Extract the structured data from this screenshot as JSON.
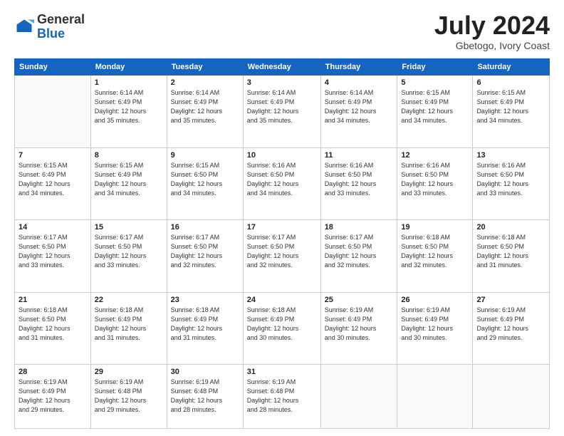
{
  "header": {
    "logo_general": "General",
    "logo_blue": "Blue",
    "title": "July 2024",
    "location": "Gbetogo, Ivory Coast"
  },
  "days_of_week": [
    "Sunday",
    "Monday",
    "Tuesday",
    "Wednesday",
    "Thursday",
    "Friday",
    "Saturday"
  ],
  "weeks": [
    [
      {
        "day": "",
        "info": ""
      },
      {
        "day": "1",
        "info": "Sunrise: 6:14 AM\nSunset: 6:49 PM\nDaylight: 12 hours\nand 35 minutes."
      },
      {
        "day": "2",
        "info": "Sunrise: 6:14 AM\nSunset: 6:49 PM\nDaylight: 12 hours\nand 35 minutes."
      },
      {
        "day": "3",
        "info": "Sunrise: 6:14 AM\nSunset: 6:49 PM\nDaylight: 12 hours\nand 35 minutes."
      },
      {
        "day": "4",
        "info": "Sunrise: 6:14 AM\nSunset: 6:49 PM\nDaylight: 12 hours\nand 34 minutes."
      },
      {
        "day": "5",
        "info": "Sunrise: 6:15 AM\nSunset: 6:49 PM\nDaylight: 12 hours\nand 34 minutes."
      },
      {
        "day": "6",
        "info": "Sunrise: 6:15 AM\nSunset: 6:49 PM\nDaylight: 12 hours\nand 34 minutes."
      }
    ],
    [
      {
        "day": "7",
        "info": "Sunrise: 6:15 AM\nSunset: 6:49 PM\nDaylight: 12 hours\nand 34 minutes."
      },
      {
        "day": "8",
        "info": "Sunrise: 6:15 AM\nSunset: 6:49 PM\nDaylight: 12 hours\nand 34 minutes."
      },
      {
        "day": "9",
        "info": "Sunrise: 6:15 AM\nSunset: 6:50 PM\nDaylight: 12 hours\nand 34 minutes."
      },
      {
        "day": "10",
        "info": "Sunrise: 6:16 AM\nSunset: 6:50 PM\nDaylight: 12 hours\nand 34 minutes."
      },
      {
        "day": "11",
        "info": "Sunrise: 6:16 AM\nSunset: 6:50 PM\nDaylight: 12 hours\nand 33 minutes."
      },
      {
        "day": "12",
        "info": "Sunrise: 6:16 AM\nSunset: 6:50 PM\nDaylight: 12 hours\nand 33 minutes."
      },
      {
        "day": "13",
        "info": "Sunrise: 6:16 AM\nSunset: 6:50 PM\nDaylight: 12 hours\nand 33 minutes."
      }
    ],
    [
      {
        "day": "14",
        "info": "Sunrise: 6:17 AM\nSunset: 6:50 PM\nDaylight: 12 hours\nand 33 minutes."
      },
      {
        "day": "15",
        "info": "Sunrise: 6:17 AM\nSunset: 6:50 PM\nDaylight: 12 hours\nand 33 minutes."
      },
      {
        "day": "16",
        "info": "Sunrise: 6:17 AM\nSunset: 6:50 PM\nDaylight: 12 hours\nand 32 minutes."
      },
      {
        "day": "17",
        "info": "Sunrise: 6:17 AM\nSunset: 6:50 PM\nDaylight: 12 hours\nand 32 minutes."
      },
      {
        "day": "18",
        "info": "Sunrise: 6:17 AM\nSunset: 6:50 PM\nDaylight: 12 hours\nand 32 minutes."
      },
      {
        "day": "19",
        "info": "Sunrise: 6:18 AM\nSunset: 6:50 PM\nDaylight: 12 hours\nand 32 minutes."
      },
      {
        "day": "20",
        "info": "Sunrise: 6:18 AM\nSunset: 6:50 PM\nDaylight: 12 hours\nand 31 minutes."
      }
    ],
    [
      {
        "day": "21",
        "info": "Sunrise: 6:18 AM\nSunset: 6:50 PM\nDaylight: 12 hours\nand 31 minutes."
      },
      {
        "day": "22",
        "info": "Sunrise: 6:18 AM\nSunset: 6:49 PM\nDaylight: 12 hours\nand 31 minutes."
      },
      {
        "day": "23",
        "info": "Sunrise: 6:18 AM\nSunset: 6:49 PM\nDaylight: 12 hours\nand 31 minutes."
      },
      {
        "day": "24",
        "info": "Sunrise: 6:18 AM\nSunset: 6:49 PM\nDaylight: 12 hours\nand 30 minutes."
      },
      {
        "day": "25",
        "info": "Sunrise: 6:19 AM\nSunset: 6:49 PM\nDaylight: 12 hours\nand 30 minutes."
      },
      {
        "day": "26",
        "info": "Sunrise: 6:19 AM\nSunset: 6:49 PM\nDaylight: 12 hours\nand 30 minutes."
      },
      {
        "day": "27",
        "info": "Sunrise: 6:19 AM\nSunset: 6:49 PM\nDaylight: 12 hours\nand 29 minutes."
      }
    ],
    [
      {
        "day": "28",
        "info": "Sunrise: 6:19 AM\nSunset: 6:49 PM\nDaylight: 12 hours\nand 29 minutes."
      },
      {
        "day": "29",
        "info": "Sunrise: 6:19 AM\nSunset: 6:48 PM\nDaylight: 12 hours\nand 29 minutes."
      },
      {
        "day": "30",
        "info": "Sunrise: 6:19 AM\nSunset: 6:48 PM\nDaylight: 12 hours\nand 28 minutes."
      },
      {
        "day": "31",
        "info": "Sunrise: 6:19 AM\nSunset: 6:48 PM\nDaylight: 12 hours\nand 28 minutes."
      },
      {
        "day": "",
        "info": ""
      },
      {
        "day": "",
        "info": ""
      },
      {
        "day": "",
        "info": ""
      }
    ]
  ]
}
